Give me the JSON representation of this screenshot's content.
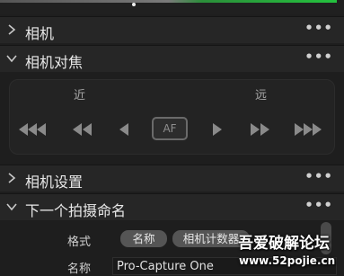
{
  "panels": {
    "camera": {
      "title": "相机",
      "more": "•••",
      "expanded": false
    },
    "camera_focus": {
      "title": "相机对焦",
      "more": "•••",
      "expanded": true
    },
    "camera_settings": {
      "title": "相机设置",
      "more": "•••",
      "expanded": false
    },
    "next_capture_naming": {
      "title": "下一个拍摄命名",
      "more": "•••",
      "expanded": true
    }
  },
  "focus": {
    "near_label": "近",
    "far_label": "远",
    "af_label": "AF",
    "buttons": [
      "triple-left",
      "double-left",
      "single-left",
      "af",
      "single-right",
      "double-right",
      "triple-right"
    ]
  },
  "naming": {
    "format_label": "格式",
    "format_tokens": [
      "名称",
      "相机计数器"
    ],
    "name_label": "名称",
    "name_value": "Pro-Capture One"
  },
  "watermark": {
    "line1": "吾爱破解论坛",
    "line2": "www.52pojie.cn"
  },
  "colors": {
    "background": "#1e1e1e",
    "header": "#262626",
    "pill": "#555555",
    "accent_green": "#24c23e"
  }
}
